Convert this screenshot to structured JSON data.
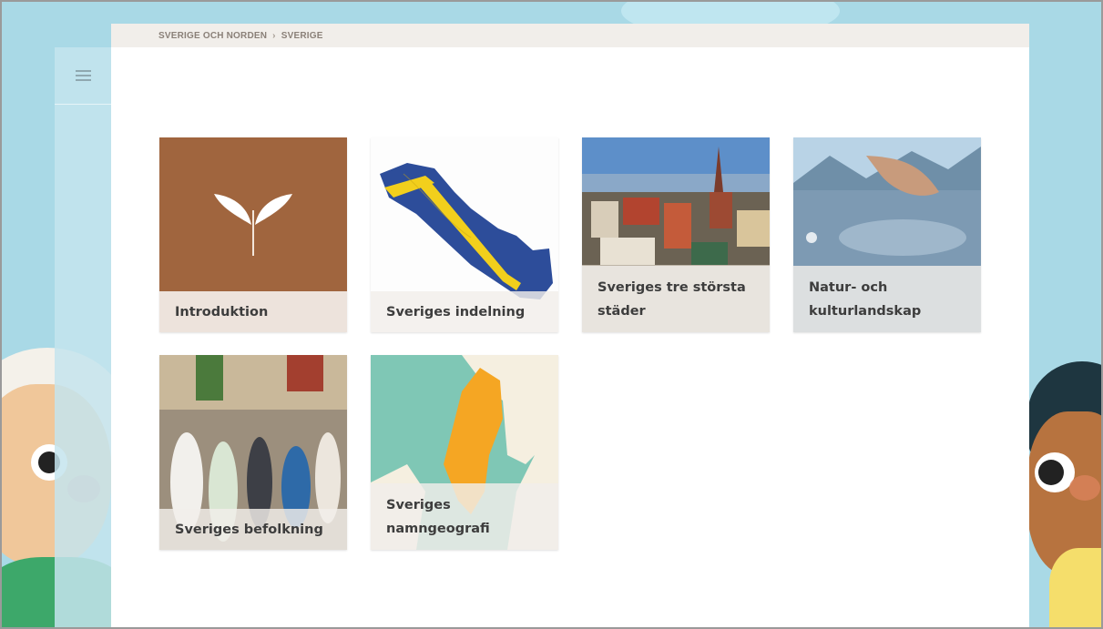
{
  "breadcrumb": {
    "items": [
      "SVERIGE OCH NORDEN",
      "SVERIGE"
    ],
    "separator": "›"
  },
  "tiles": [
    {
      "label": "Introduktion",
      "color": "#a0653e"
    },
    {
      "label": "Sveriges indelning"
    },
    {
      "label": "Sveriges tre största städer"
    },
    {
      "label": "Natur- och kulturlandskap"
    },
    {
      "label": "Sveriges befolkning"
    },
    {
      "label": "Sveriges namngeografi"
    }
  ],
  "icons": {
    "menu": "hamburger-icon",
    "introduktion": "sprout-icon"
  },
  "colors": {
    "background": "#a9d9e6",
    "breadcrumb_bar": "#f1eeea",
    "caption_text": "#3d3d3d",
    "sweden_map": "#f5a623"
  }
}
